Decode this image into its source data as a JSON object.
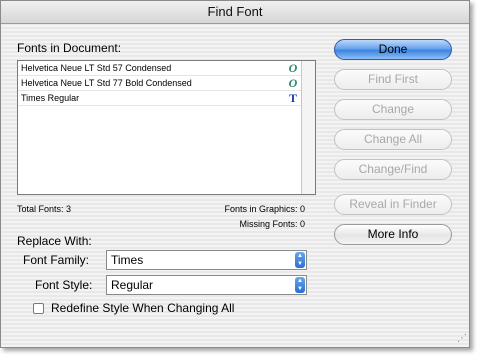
{
  "window": {
    "title": "Find Font"
  },
  "fonts_section": {
    "heading": "Fonts in Document:",
    "fonts": [
      {
        "name": "Helvetica Neue LT Std 57 Condensed",
        "type_icon": "opentype-icon",
        "glyph": "O"
      },
      {
        "name": "Helvetica Neue LT Std 77 Bold Condensed",
        "type_icon": "opentype-icon",
        "glyph": "O"
      },
      {
        "name": "Times Regular",
        "type_icon": "truetype-icon",
        "glyph": "T"
      }
    ],
    "total_fonts": "Total Fonts: 3",
    "fonts_in_graphics": "Fonts in Graphics: 0",
    "missing_fonts": "Missing Fonts: 0"
  },
  "buttons": {
    "done": "Done",
    "find_first": "Find First",
    "change": "Change",
    "change_all": "Change All",
    "change_find": "Change/Find",
    "reveal_in_finder": "Reveal in Finder",
    "more_info": "More Info"
  },
  "replace": {
    "heading": "Replace With:",
    "font_family_label": "Font Family:",
    "font_family_value": "Times",
    "font_style_label": "Font Style:",
    "font_style_value": "Regular",
    "redefine_label": "Redefine Style When Changing All",
    "redefine_checked": false
  },
  "colors": {
    "default_button": "#3c84e0",
    "opentype_icon": "#2a8a6a",
    "truetype_icon": "#1e3ca8"
  }
}
